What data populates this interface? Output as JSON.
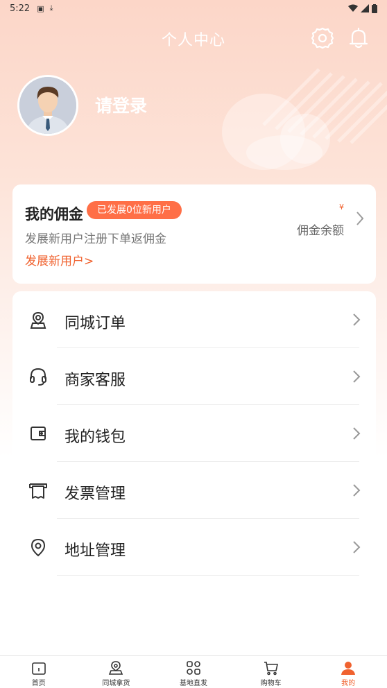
{
  "status_bar": {
    "time": "5:22"
  },
  "header": {
    "title": "个人中心",
    "settings_icon": "gear-icon",
    "notification_icon": "bell-icon"
  },
  "profile": {
    "login_text": "请登录",
    "avatar_icon": "person-avatar"
  },
  "commission": {
    "title": "我的佣金",
    "badge": "已发展0位新用户",
    "description": "发展新用户注册下单返佣金",
    "link": "发展新用户>",
    "currency": "¥",
    "balance_label": "佣金余额"
  },
  "menu": {
    "items": [
      {
        "label": "同城订单",
        "icon": "location-person-icon"
      },
      {
        "label": "商家客服",
        "icon": "headset-icon"
      },
      {
        "label": "我的钱包",
        "icon": "wallet-icon"
      },
      {
        "label": "发票管理",
        "icon": "invoice-icon"
      },
      {
        "label": "地址管理",
        "icon": "location-pin-icon"
      }
    ]
  },
  "tabbar": {
    "tabs": [
      {
        "label": "首页",
        "icon": "home-icon",
        "active": false
      },
      {
        "label": "同城拿货",
        "icon": "pickup-icon",
        "active": false
      },
      {
        "label": "基地直发",
        "icon": "grid-icon",
        "active": false
      },
      {
        "label": "购物车",
        "icon": "cart-icon",
        "active": false
      },
      {
        "label": "我的",
        "icon": "profile-icon",
        "active": true
      }
    ]
  },
  "colors": {
    "accent": "#f0622f",
    "badge": "#ff6f47",
    "header_bg": "#fcd6c8"
  }
}
